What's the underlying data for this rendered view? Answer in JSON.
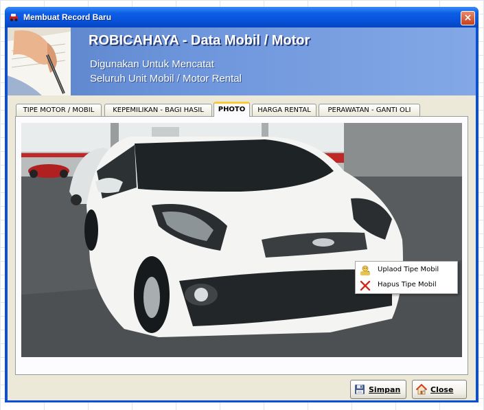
{
  "window": {
    "title": "Membuat Record Baru",
    "close_label": "×"
  },
  "banner": {
    "title": "ROBICAHAYA - Data Mobil / Motor",
    "subtitle_line1": "Digunakan Untuk Mencatat",
    "subtitle_line2": "Seluruh Unit Mobil / Motor Rental"
  },
  "tabs": [
    {
      "label": "TIPE MOTOR / MOBIL",
      "active": false
    },
    {
      "label": "KEPEMILIKAN - BAGI HASIL",
      "active": false
    },
    {
      "label": "PHOTO",
      "active": true
    },
    {
      "label": "HARGA RENTAL",
      "active": false
    },
    {
      "label": "PERAWATAN - GANTI OLI",
      "active": false
    }
  ],
  "context_menu": {
    "items": [
      {
        "label": "Uplaod Tipe Mobil",
        "icon": "user-upload-icon"
      },
      {
        "label": "Hapus Tipe Mobil",
        "icon": "delete-x-icon"
      }
    ]
  },
  "buttons": {
    "save_label": "Simpan",
    "save_icon": "floppy-disk-icon",
    "close_label": "Close",
    "close_icon": "home-icon"
  },
  "colors": {
    "titlebar": "#0a54e0",
    "banner": "#6e96dc",
    "active_tab_accent": "#ffc83c",
    "window_face": "#ece9d8"
  }
}
